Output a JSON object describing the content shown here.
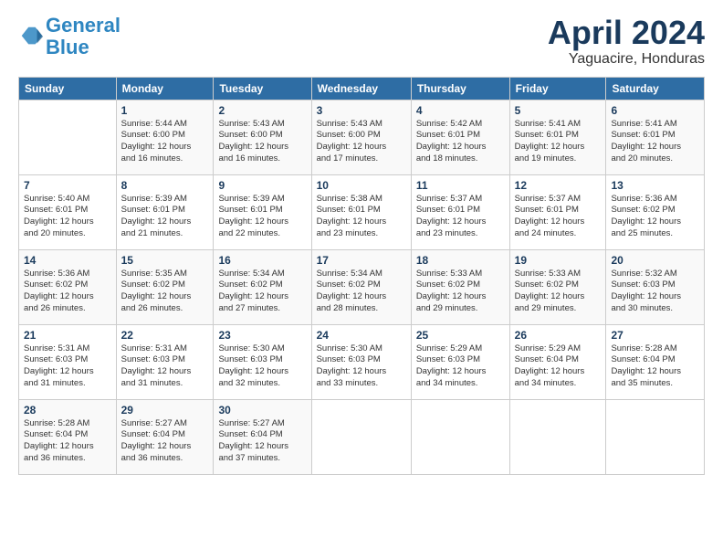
{
  "logo": {
    "line1": "General",
    "line2": "Blue"
  },
  "header": {
    "month": "April 2024",
    "location": "Yaguacire, Honduras"
  },
  "columns": [
    "Sunday",
    "Monday",
    "Tuesday",
    "Wednesday",
    "Thursday",
    "Friday",
    "Saturday"
  ],
  "weeks": [
    [
      {
        "day": "",
        "info": ""
      },
      {
        "day": "1",
        "info": "Sunrise: 5:44 AM\nSunset: 6:00 PM\nDaylight: 12 hours\nand 16 minutes."
      },
      {
        "day": "2",
        "info": "Sunrise: 5:43 AM\nSunset: 6:00 PM\nDaylight: 12 hours\nand 16 minutes."
      },
      {
        "day": "3",
        "info": "Sunrise: 5:43 AM\nSunset: 6:00 PM\nDaylight: 12 hours\nand 17 minutes."
      },
      {
        "day": "4",
        "info": "Sunrise: 5:42 AM\nSunset: 6:01 PM\nDaylight: 12 hours\nand 18 minutes."
      },
      {
        "day": "5",
        "info": "Sunrise: 5:41 AM\nSunset: 6:01 PM\nDaylight: 12 hours\nand 19 minutes."
      },
      {
        "day": "6",
        "info": "Sunrise: 5:41 AM\nSunset: 6:01 PM\nDaylight: 12 hours\nand 20 minutes."
      }
    ],
    [
      {
        "day": "7",
        "info": "Sunrise: 5:40 AM\nSunset: 6:01 PM\nDaylight: 12 hours\nand 20 minutes."
      },
      {
        "day": "8",
        "info": "Sunrise: 5:39 AM\nSunset: 6:01 PM\nDaylight: 12 hours\nand 21 minutes."
      },
      {
        "day": "9",
        "info": "Sunrise: 5:39 AM\nSunset: 6:01 PM\nDaylight: 12 hours\nand 22 minutes."
      },
      {
        "day": "10",
        "info": "Sunrise: 5:38 AM\nSunset: 6:01 PM\nDaylight: 12 hours\nand 23 minutes."
      },
      {
        "day": "11",
        "info": "Sunrise: 5:37 AM\nSunset: 6:01 PM\nDaylight: 12 hours\nand 23 minutes."
      },
      {
        "day": "12",
        "info": "Sunrise: 5:37 AM\nSunset: 6:01 PM\nDaylight: 12 hours\nand 24 minutes."
      },
      {
        "day": "13",
        "info": "Sunrise: 5:36 AM\nSunset: 6:02 PM\nDaylight: 12 hours\nand 25 minutes."
      }
    ],
    [
      {
        "day": "14",
        "info": "Sunrise: 5:36 AM\nSunset: 6:02 PM\nDaylight: 12 hours\nand 26 minutes."
      },
      {
        "day": "15",
        "info": "Sunrise: 5:35 AM\nSunset: 6:02 PM\nDaylight: 12 hours\nand 26 minutes."
      },
      {
        "day": "16",
        "info": "Sunrise: 5:34 AM\nSunset: 6:02 PM\nDaylight: 12 hours\nand 27 minutes."
      },
      {
        "day": "17",
        "info": "Sunrise: 5:34 AM\nSunset: 6:02 PM\nDaylight: 12 hours\nand 28 minutes."
      },
      {
        "day": "18",
        "info": "Sunrise: 5:33 AM\nSunset: 6:02 PM\nDaylight: 12 hours\nand 29 minutes."
      },
      {
        "day": "19",
        "info": "Sunrise: 5:33 AM\nSunset: 6:02 PM\nDaylight: 12 hours\nand 29 minutes."
      },
      {
        "day": "20",
        "info": "Sunrise: 5:32 AM\nSunset: 6:03 PM\nDaylight: 12 hours\nand 30 minutes."
      }
    ],
    [
      {
        "day": "21",
        "info": "Sunrise: 5:31 AM\nSunset: 6:03 PM\nDaylight: 12 hours\nand 31 minutes."
      },
      {
        "day": "22",
        "info": "Sunrise: 5:31 AM\nSunset: 6:03 PM\nDaylight: 12 hours\nand 31 minutes."
      },
      {
        "day": "23",
        "info": "Sunrise: 5:30 AM\nSunset: 6:03 PM\nDaylight: 12 hours\nand 32 minutes."
      },
      {
        "day": "24",
        "info": "Sunrise: 5:30 AM\nSunset: 6:03 PM\nDaylight: 12 hours\nand 33 minutes."
      },
      {
        "day": "25",
        "info": "Sunrise: 5:29 AM\nSunset: 6:03 PM\nDaylight: 12 hours\nand 34 minutes."
      },
      {
        "day": "26",
        "info": "Sunrise: 5:29 AM\nSunset: 6:04 PM\nDaylight: 12 hours\nand 34 minutes."
      },
      {
        "day": "27",
        "info": "Sunrise: 5:28 AM\nSunset: 6:04 PM\nDaylight: 12 hours\nand 35 minutes."
      }
    ],
    [
      {
        "day": "28",
        "info": "Sunrise: 5:28 AM\nSunset: 6:04 PM\nDaylight: 12 hours\nand 36 minutes."
      },
      {
        "day": "29",
        "info": "Sunrise: 5:27 AM\nSunset: 6:04 PM\nDaylight: 12 hours\nand 36 minutes."
      },
      {
        "day": "30",
        "info": "Sunrise: 5:27 AM\nSunset: 6:04 PM\nDaylight: 12 hours\nand 37 minutes."
      },
      {
        "day": "",
        "info": ""
      },
      {
        "day": "",
        "info": ""
      },
      {
        "day": "",
        "info": ""
      },
      {
        "day": "",
        "info": ""
      }
    ]
  ]
}
